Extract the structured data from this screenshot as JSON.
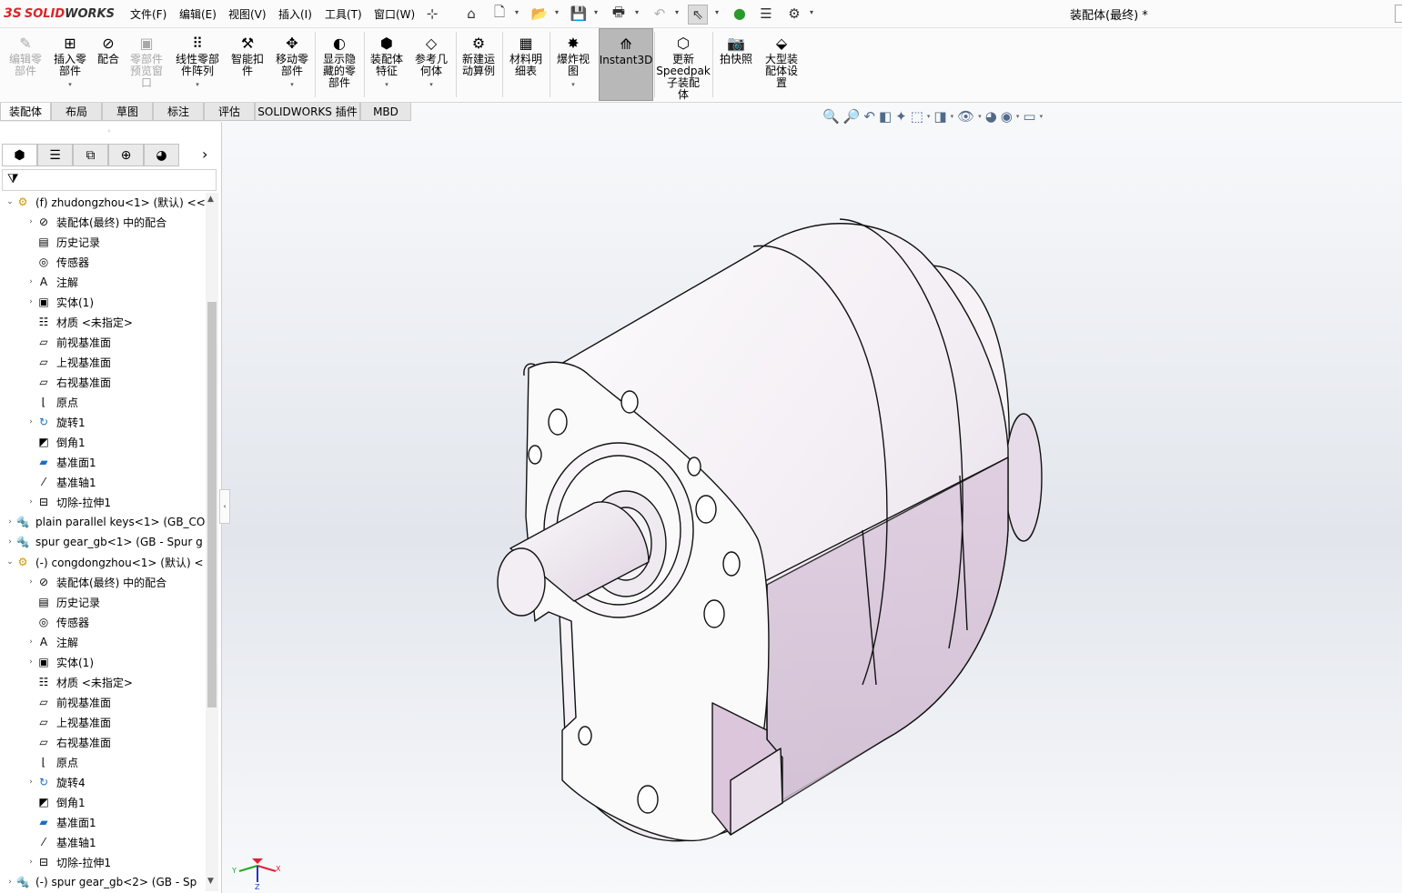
{
  "app": {
    "logo_mark": "3S",
    "logo_solid": "SOLID",
    "logo_works": "WORKS",
    "doc_title": "装配体(最终) *"
  },
  "menu": [
    "文件(F)",
    "编辑(E)",
    "视图(V)",
    "插入(I)",
    "工具(T)",
    "窗口(W)"
  ],
  "quick_access": {
    "pin": "⊹",
    "home": "⌂",
    "new": "🗋",
    "open": "📂",
    "save": "💾",
    "print": "🖶",
    "undo": "↶",
    "select": "⇖",
    "rebuild": "⬤",
    "options_list": "☰",
    "settings": "⚙"
  },
  "ribbon": [
    {
      "line1": "编辑零",
      "line2": "部件",
      "line3": "",
      "icon": "edit-component-icon",
      "glyph": "✎",
      "disabled": true
    },
    {
      "line1": "插入零",
      "line2": "部件",
      "line3": "",
      "icon": "insert-component-icon",
      "glyph": "⊞",
      "disabled": false,
      "arrow": true
    },
    {
      "line1": "配合",
      "line2": "",
      "line3": "",
      "icon": "mate-icon",
      "glyph": "⊘",
      "disabled": false
    },
    {
      "line1": "零部件",
      "line2": "预览窗",
      "line3": "口",
      "icon": "component-preview-icon",
      "glyph": "▣",
      "disabled": true
    },
    {
      "line1": "线性零部",
      "line2": "件阵列",
      "line3": "",
      "icon": "linear-pattern-icon",
      "glyph": "⠿",
      "disabled": false,
      "arrow": true
    },
    {
      "line1": "智能扣",
      "line2": "件",
      "line3": "",
      "icon": "smart-fasteners-icon",
      "glyph": "⚒",
      "disabled": false
    },
    {
      "line1": "移动零",
      "line2": "部件",
      "line3": "",
      "icon": "move-component-icon",
      "glyph": "✥",
      "disabled": false,
      "arrow": true
    },
    {
      "line1": "显示隐",
      "line2": "藏的零",
      "line3": "部件",
      "icon": "show-hidden-icon",
      "glyph": "◐",
      "disabled": false
    },
    {
      "line1": "装配体",
      "line2": "特征",
      "line3": "",
      "icon": "assembly-features-icon",
      "glyph": "⬢",
      "disabled": false,
      "arrow": true
    },
    {
      "line1": "参考几",
      "line2": "何体",
      "line3": "",
      "icon": "reference-geometry-icon",
      "glyph": "◇",
      "disabled": false,
      "arrow": true
    },
    {
      "line1": "新建运",
      "line2": "动算例",
      "line3": "",
      "icon": "motion-study-icon",
      "glyph": "⚙",
      "disabled": false
    },
    {
      "line1": "材料明",
      "line2": "细表",
      "line3": "",
      "icon": "bom-icon",
      "glyph": "▦",
      "disabled": false
    },
    {
      "line1": "爆炸视",
      "line2": "图",
      "line3": "",
      "icon": "exploded-view-icon",
      "glyph": "✸",
      "disabled": false,
      "arrow": true
    },
    {
      "line1": "Instant3D",
      "line2": "",
      "line3": "",
      "icon": "instant3d-icon",
      "glyph": "⟰",
      "disabled": false
    },
    {
      "line1": "更新",
      "line2": "Speedpak",
      "line3": "子装配",
      "line4": "体",
      "icon": "speedpak-icon",
      "glyph": "⬡",
      "disabled": false
    },
    {
      "line1": "拍快照",
      "line2": "",
      "line3": "",
      "icon": "snapshot-icon",
      "glyph": "📷",
      "disabled": false
    },
    {
      "line1": "大型装",
      "line2": "配体设",
      "line3": "置",
      "icon": "large-assembly-icon",
      "glyph": "⬙",
      "disabled": false
    }
  ],
  "tabs": [
    "装配体",
    "布局",
    "草图",
    "标注",
    "评估",
    "SOLIDWORKS 插件",
    "MBD"
  ],
  "tree": [
    {
      "level": 0,
      "expand": "⌄",
      "icon": "assembly-part-icon",
      "glyph": "⚙",
      "label": "(f) zhudongzhou<1> (默认) <<"
    },
    {
      "level": 1,
      "expand": "›",
      "icon": "mates-folder-icon",
      "glyph": "⊘",
      "label": "装配体(最终) 中的配合"
    },
    {
      "level": 1,
      "expand": "",
      "icon": "history-icon",
      "glyph": "▤",
      "label": "历史记录"
    },
    {
      "level": 1,
      "expand": "",
      "icon": "sensor-icon",
      "glyph": "◎",
      "label": "传感器"
    },
    {
      "level": 1,
      "expand": "›",
      "icon": "annotation-icon",
      "glyph": "A",
      "label": "注解"
    },
    {
      "level": 1,
      "expand": "›",
      "icon": "solid-body-icon",
      "glyph": "▣",
      "label": "实体(1)"
    },
    {
      "level": 1,
      "expand": "",
      "icon": "material-icon",
      "glyph": "☷",
      "label": "材质 <未指定>"
    },
    {
      "level": 1,
      "expand": "",
      "icon": "plane-icon",
      "glyph": "▱",
      "label": "前视基准面"
    },
    {
      "level": 1,
      "expand": "",
      "icon": "plane-icon",
      "glyph": "▱",
      "label": "上视基准面"
    },
    {
      "level": 1,
      "expand": "",
      "icon": "plane-icon",
      "glyph": "▱",
      "label": "右视基准面"
    },
    {
      "level": 1,
      "expand": "",
      "icon": "origin-icon",
      "glyph": "⌊",
      "label": "原点"
    },
    {
      "level": 1,
      "expand": "›",
      "icon": "revolve-icon",
      "glyph": "↻",
      "label": "旋转1"
    },
    {
      "level": 1,
      "expand": "",
      "icon": "chamfer-icon",
      "glyph": "◩",
      "label": "倒角1"
    },
    {
      "level": 1,
      "expand": "",
      "icon": "ref-plane-icon",
      "glyph": "▰",
      "label": "基准面1"
    },
    {
      "level": 1,
      "expand": "",
      "icon": "axis-icon",
      "glyph": "⁄",
      "label": "基准轴1"
    },
    {
      "level": 1,
      "expand": "›",
      "icon": "cut-extrude-icon",
      "glyph": "⊟",
      "label": "切除-拉伸1"
    },
    {
      "level": 0,
      "expand": "›",
      "icon": "part-icon",
      "glyph": "🔩",
      "label": "plain parallel keys<1> (GB_CO"
    },
    {
      "level": 0,
      "expand": "›",
      "icon": "part-icon",
      "glyph": "🔩",
      "label": "spur gear_gb<1> (GB - Spur g"
    },
    {
      "level": 0,
      "expand": "⌄",
      "icon": "assembly-part-icon",
      "glyph": "⚙",
      "label": "(-) congdongzhou<1> (默认) <"
    },
    {
      "level": 1,
      "expand": "›",
      "icon": "mates-folder-icon",
      "glyph": "⊘",
      "label": "装配体(最终) 中的配合"
    },
    {
      "level": 1,
      "expand": "",
      "icon": "history-icon",
      "glyph": "▤",
      "label": "历史记录"
    },
    {
      "level": 1,
      "expand": "",
      "icon": "sensor-icon",
      "glyph": "◎",
      "label": "传感器"
    },
    {
      "level": 1,
      "expand": "›",
      "icon": "annotation-icon",
      "glyph": "A",
      "label": "注解"
    },
    {
      "level": 1,
      "expand": "›",
      "icon": "solid-body-icon",
      "glyph": "▣",
      "label": "实体(1)"
    },
    {
      "level": 1,
      "expand": "",
      "icon": "material-icon",
      "glyph": "☷",
      "label": "材质 <未指定>"
    },
    {
      "level": 1,
      "expand": "",
      "icon": "plane-icon",
      "glyph": "▱",
      "label": "前视基准面"
    },
    {
      "level": 1,
      "expand": "",
      "icon": "plane-icon",
      "glyph": "▱",
      "label": "上视基准面"
    },
    {
      "level": 1,
      "expand": "",
      "icon": "plane-icon",
      "glyph": "▱",
      "label": "右视基准面"
    },
    {
      "level": 1,
      "expand": "",
      "icon": "origin-icon",
      "glyph": "⌊",
      "label": "原点"
    },
    {
      "level": 1,
      "expand": "›",
      "icon": "revolve-icon",
      "glyph": "↻",
      "label": "旋转4"
    },
    {
      "level": 1,
      "expand": "",
      "icon": "chamfer-icon",
      "glyph": "◩",
      "label": "倒角1"
    },
    {
      "level": 1,
      "expand": "",
      "icon": "ref-plane-icon",
      "glyph": "▰",
      "label": "基准面1"
    },
    {
      "level": 1,
      "expand": "",
      "icon": "axis-icon",
      "glyph": "⁄",
      "label": "基准轴1"
    },
    {
      "level": 1,
      "expand": "›",
      "icon": "cut-extrude-icon",
      "glyph": "⊟",
      "label": "切除-拉伸1"
    },
    {
      "level": 0,
      "expand": "›",
      "icon": "part-icon",
      "glyph": "🔩",
      "label": "(-) spur gear_gb<2> (GB - Sp"
    }
  ],
  "triad": {
    "x": "X",
    "y": "Y",
    "z": "Z"
  },
  "colors": {
    "accent": "#d8262a",
    "body": "#f2f0f3",
    "body_tint": "#dbc6dc"
  }
}
